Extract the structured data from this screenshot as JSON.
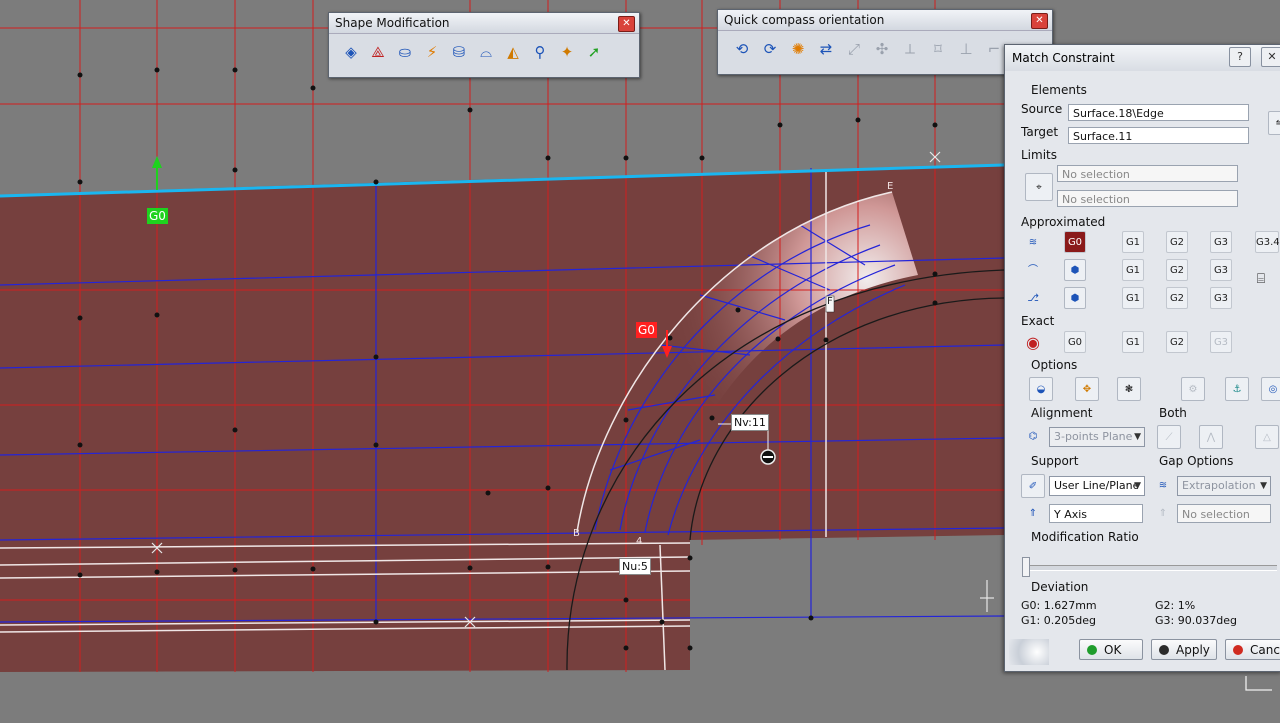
{
  "toolbars": {
    "shape_modification": {
      "title": "Shape Modification",
      "icons": [
        "match-surface-icon",
        "fill-icon",
        "global-deformation-icon",
        "extend-icon",
        "shape-fillet-icon",
        "blend-icon",
        "styling-fillet-icon",
        "translate-icon",
        "control-points-icon",
        "match-constraint-icon"
      ]
    },
    "quick_compass": {
      "title": "Quick compass orientation",
      "icons": [
        "rotate-xy-icon",
        "rotate-yz-icon",
        "rotate-xz-icon",
        "compass-to-screen-icon",
        "compass-privileged-icon",
        "compass-rotate-icon",
        "compass-center-icon",
        "compass-reset-icon",
        "compass-align-icon",
        "compass-exact-icon"
      ]
    }
  },
  "viewport": {
    "labels": {
      "g0_top": "G0",
      "g0_mid": "G0",
      "nv": "Nv:11",
      "nu": "Nu:5",
      "pt_e": "E",
      "pt_f": "F",
      "pt_b": "B",
      "pt_4": "4"
    },
    "colors": {
      "surface": "#76403e",
      "grid_red": "#d21e1e",
      "grid_blue": "#2424d8",
      "edge_cyan": "#1ab6f0"
    }
  },
  "panel": {
    "title": "Match Constraint",
    "help_label": "?",
    "close_label": "✕",
    "elements": {
      "heading": "Elements",
      "source_label": "Source",
      "source_value": "Surface.18\\Edge",
      "target_label": "Target",
      "target_value": "Surface.11"
    },
    "limits": {
      "heading": "Limits",
      "first": "No selection",
      "second": "No selection"
    },
    "approximated": {
      "heading": "Approximated",
      "row1": [
        "G0",
        "G1",
        "G2",
        "G3",
        "G3.4"
      ],
      "row2": [
        "G1",
        "G2",
        "G3"
      ],
      "row3": [
        "G1",
        "G2",
        "G3"
      ]
    },
    "exact": {
      "heading": "Exact",
      "buttons": [
        "G0",
        "G1",
        "G2",
        "G3"
      ]
    },
    "options": {
      "heading": "Options"
    },
    "alignment": {
      "heading": "Alignment",
      "value": "3-points Plane"
    },
    "both": {
      "heading": "Both"
    },
    "support": {
      "heading": "Support",
      "value": "User Line/Plane",
      "axis": "Y Axis"
    },
    "gap_options": {
      "heading": "Gap Options",
      "value": "Extrapolation",
      "selection": "No selection"
    },
    "ratio": {
      "heading": "Modification Ratio",
      "value": 0
    },
    "deviation": {
      "heading": "Deviation",
      "g0": "G0: 1.627mm",
      "g1": "G1: 0.205deg",
      "g2": "G2: 1%",
      "g3": "G3: 90.037deg"
    },
    "buttons": {
      "ok": "OK",
      "apply": "Apply",
      "cancel": "Cancel"
    }
  }
}
